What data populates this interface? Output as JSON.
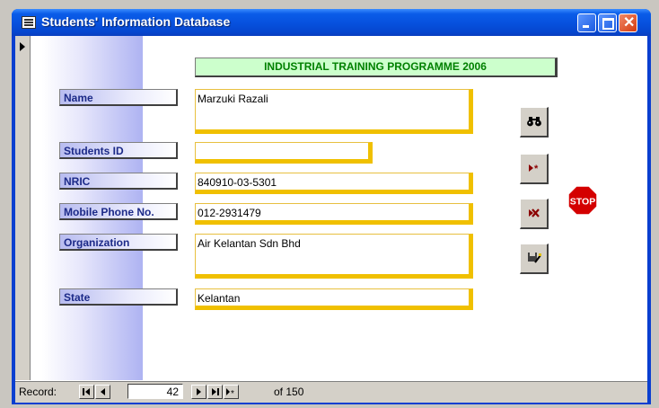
{
  "window": {
    "title": "Students' Information Database"
  },
  "form": {
    "heading": "INDUSTRIAL TRAINING PROGRAMME 2006",
    "fields": [
      {
        "label": "Name",
        "value": "Marzuki Razali"
      },
      {
        "label": "Students ID",
        "value": ""
      },
      {
        "label": "NRIC",
        "value": "840910-03-5301"
      },
      {
        "label": "Mobile Phone No.",
        "value": "012-2931479"
      },
      {
        "label": "Organization",
        "value": "Air Kelantan Sdn Bhd"
      },
      {
        "label": "State",
        "value": "Kelantan"
      }
    ],
    "stop_label": "STOP"
  },
  "navigation": {
    "record_label": "Record:",
    "current_record": "42",
    "of_label": "of 150"
  },
  "colors": {
    "heading_bg": "#ccffcc",
    "heading_text": "#008000",
    "field_shadow": "#f0c000",
    "label_text": "#1c2a88",
    "stop": "#d40000"
  },
  "icons": [
    "binoculars-icon",
    "new-record-icon",
    "delete-record-icon",
    "save-record-icon",
    "stop-icon"
  ]
}
